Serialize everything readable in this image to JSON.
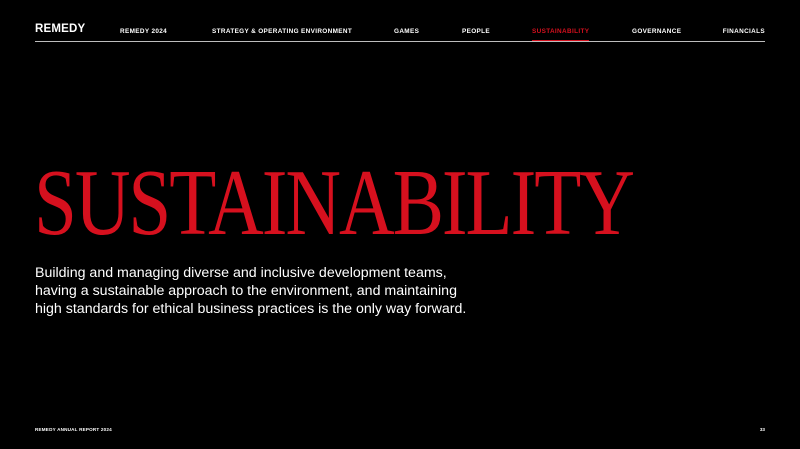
{
  "header": {
    "logo": "REMEDY",
    "nav": [
      {
        "label": "REMEDY 2024",
        "active": false
      },
      {
        "label": "STRATEGY & OPERATING ENVIRONMENT",
        "active": false
      },
      {
        "label": "GAMES",
        "active": false
      },
      {
        "label": "PEOPLE",
        "active": false
      },
      {
        "label": "SUSTAINABILITY",
        "active": true
      },
      {
        "label": "GOVERNANCE",
        "active": false
      },
      {
        "label": "FINANCIALS",
        "active": false
      }
    ]
  },
  "main": {
    "title": "SUSTAINABILITY",
    "intro": "Building and managing diverse and inclusive development teams, having a sustainable approach to the environment, and maintaining high standards for ethical business practices is the only way forward."
  },
  "footer": {
    "report_label": "REMEDY ANNUAL REPORT 2024",
    "page_number": "33"
  },
  "colors": {
    "background": "#000000",
    "accent": "#d6101e",
    "text": "#ffffff"
  }
}
